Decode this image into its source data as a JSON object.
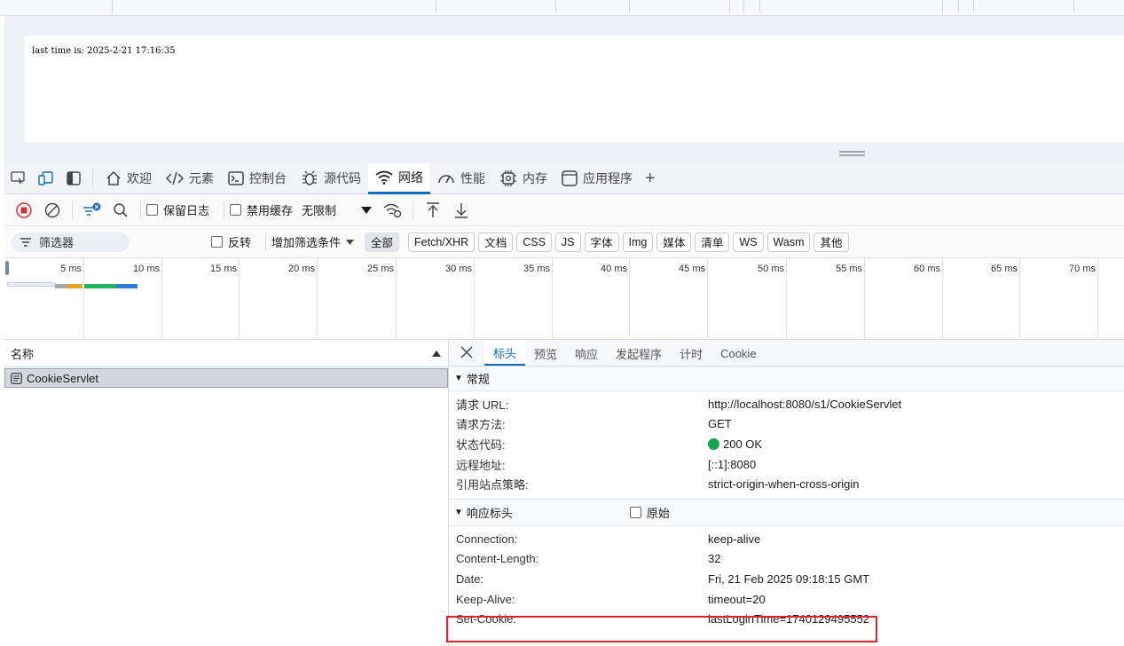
{
  "page": {
    "text": "last time is: 2025-2-21 17:16:35"
  },
  "devtools": {
    "tabs": [
      {
        "label": "欢迎",
        "icon": "home-icon"
      },
      {
        "label": "元素",
        "icon": "code-icon"
      },
      {
        "label": "控制台",
        "icon": "console-icon"
      },
      {
        "label": "源代码",
        "icon": "bug-icon"
      },
      {
        "label": "网络",
        "icon": "wifi-icon",
        "active": true
      },
      {
        "label": "性能",
        "icon": "performance-icon"
      },
      {
        "label": "内存",
        "icon": "memory-icon"
      },
      {
        "label": "应用程序",
        "icon": "application-icon"
      }
    ],
    "add_tab": "+"
  },
  "network_toolbar": {
    "preserve_log": "保留日志",
    "disable_cache": "禁用缓存",
    "throttling": "无限制"
  },
  "filter_bar": {
    "filter_placeholder": "筛选器",
    "invert": "反转",
    "more_filters": "增加筛选条件",
    "types": [
      "全部",
      "Fetch/XHR",
      "文档",
      "CSS",
      "JS",
      "字体",
      "Img",
      "媒体",
      "清单",
      "WS",
      "Wasm",
      "其他"
    ],
    "active_type": "全部"
  },
  "timeline": {
    "ticks": [
      "5 ms",
      "10 ms",
      "15 ms",
      "20 ms",
      "25 ms",
      "30 ms",
      "35 ms",
      "40 ms",
      "45 ms",
      "50 ms",
      "55 ms",
      "60 ms",
      "65 ms",
      "70 ms"
    ]
  },
  "requests": {
    "header_name": "名称",
    "rows": [
      {
        "name": "CookieServlet"
      }
    ]
  },
  "details": {
    "tabs": [
      "标头",
      "预览",
      "响应",
      "发起程序",
      "计时",
      "Cookie"
    ],
    "active_tab": "标头",
    "general": {
      "title": "常规",
      "rows": [
        {
          "key": "请求 URL:",
          "value": "http://localhost:8080/s1/CookieServlet"
        },
        {
          "key": "请求方法:",
          "value": "GET"
        },
        {
          "key": "状态代码:",
          "value": "200 OK"
        },
        {
          "key": "远程地址:",
          "value": "[::1]:8080"
        },
        {
          "key": "引用站点策略:",
          "value": "strict-origin-when-cross-origin"
        }
      ]
    },
    "response_headers": {
      "title": "响应标头",
      "raw_label": "原始",
      "rows": [
        {
          "key": "Connection:",
          "value": "keep-alive"
        },
        {
          "key": "Content-Length:",
          "value": "32"
        },
        {
          "key": "Date:",
          "value": "Fri, 21 Feb 2025 09:18:15 GMT"
        },
        {
          "key": "Keep-Alive:",
          "value": "timeout=20"
        },
        {
          "key": "Set-Cookie:",
          "value": "lastLoginTime=1740129495552"
        }
      ]
    }
  },
  "colors": {
    "accent": "#0f6cbd",
    "record": "#d13438",
    "status_ok": "#16a34a",
    "highlight": "#e0242f"
  }
}
